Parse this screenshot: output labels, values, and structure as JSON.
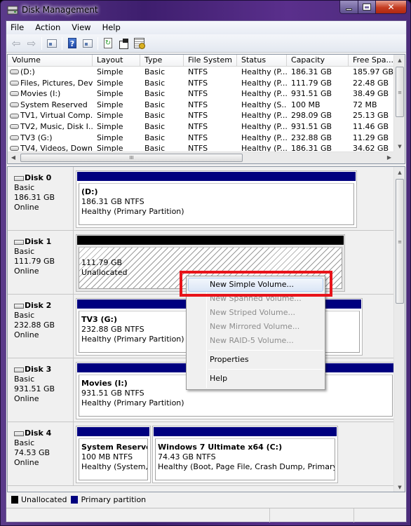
{
  "window": {
    "title": "Disk Management",
    "controls": {
      "minimize": "minimize",
      "maximize": "maximize",
      "close": "✕"
    }
  },
  "menubar": [
    "File",
    "Action",
    "View",
    "Help"
  ],
  "toolbar": {
    "buttons": [
      "back",
      "forward",
      "show-hide-console-tree",
      "help",
      "show-hide-action-pane",
      "refresh",
      "properties",
      "settings"
    ]
  },
  "volume_list": {
    "columns": [
      "Volume",
      "Layout",
      "Type",
      "File System",
      "Status",
      "Capacity",
      "Free Spa..."
    ],
    "rows": [
      [
        "(D:)",
        "Simple",
        "Basic",
        "NTFS",
        "Healthy (P...",
        "186.31 GB",
        "185.97 GB"
      ],
      [
        "Files, Pictures, Dev...",
        "Simple",
        "Basic",
        "NTFS",
        "Healthy (P...",
        "111.79 GB",
        "22.48 GB"
      ],
      [
        "Movies (I:)",
        "Simple",
        "Basic",
        "NTFS",
        "Healthy (P...",
        "931.51 GB",
        "38.49 GB"
      ],
      [
        "System Reserved",
        "Simple",
        "Basic",
        "NTFS",
        "Healthy (S...",
        "100 MB",
        "72 MB"
      ],
      [
        "TV1, Virtual Comp...",
        "Simple",
        "Basic",
        "NTFS",
        "Healthy (P...",
        "298.09 GB",
        "25.13 GB"
      ],
      [
        "TV2, Music, Disk I...",
        "Simple",
        "Basic",
        "NTFS",
        "Healthy (P...",
        "931.51 GB",
        "11.46 GB"
      ],
      [
        "TV3 (G:)",
        "Simple",
        "Basic",
        "NTFS",
        "Healthy (P...",
        "232.88 GB",
        "11.29 GB"
      ],
      [
        "TV4, Videos, Down...",
        "Simple",
        "Basic",
        "NTFS",
        "Healthy (P...",
        "186.31 GB",
        "34.62 GB"
      ]
    ],
    "hscroll_thumb_glyph": "III",
    "vscroll_thumb_glyph": "≡"
  },
  "disks": [
    {
      "name": "Disk 0",
      "type": "Basic",
      "size": "186.31 GB",
      "status": "Online",
      "partitions": [
        {
          "name": "(D:)",
          "size": "186.31 GB NTFS",
          "status": "Healthy (Primary Partition)",
          "kind": "primary"
        }
      ]
    },
    {
      "name": "Disk 1",
      "type": "Basic",
      "size": "111.79 GB",
      "status": "Online",
      "partitions": [
        {
          "name": "",
          "size": "111.79 GB",
          "status": "Unallocated",
          "kind": "unallocated"
        }
      ]
    },
    {
      "name": "Disk 2",
      "type": "Basic",
      "size": "232.88 GB",
      "status": "Online",
      "partitions": [
        {
          "name": "TV3  (G:)",
          "size": "232.88 GB NTFS",
          "status": "Healthy (Primary Partition)",
          "kind": "primary"
        }
      ]
    },
    {
      "name": "Disk 3",
      "type": "Basic",
      "size": "931.51 GB",
      "status": "Online",
      "partitions": [
        {
          "name": "Movies  (I:)",
          "size": "931.51 GB NTFS",
          "status": "Healthy (Primary Partition)",
          "kind": "primary"
        }
      ]
    },
    {
      "name": "Disk 4",
      "type": "Basic",
      "size": "74.53 GB",
      "status": "Online",
      "partitions": [
        {
          "name": "System Reserved",
          "size": "100 MB NTFS",
          "status": "Healthy (System, A",
          "kind": "primary"
        },
        {
          "name": "Windows 7 Ultimate x64  (C:)",
          "size": "74.43 GB NTFS",
          "status": "Healthy (Boot, Page File, Crash Dump, Primary Parti",
          "kind": "primary"
        }
      ]
    }
  ],
  "legend": [
    {
      "label": "Unallocated",
      "color": "#000000"
    },
    {
      "label": "Primary partition",
      "color": "#00007f"
    }
  ],
  "context_menu": {
    "items": [
      {
        "label": "New Simple Volume...",
        "enabled": true,
        "hover": true
      },
      {
        "label": "New Spanned Volume...",
        "enabled": false
      },
      {
        "label": "New Striped Volume...",
        "enabled": false
      },
      {
        "label": "New Mirrored Volume...",
        "enabled": false
      },
      {
        "label": "New RAID-5 Volume...",
        "enabled": false
      },
      {
        "label": "Properties",
        "enabled": true
      },
      {
        "label": "Help",
        "enabled": true
      }
    ]
  },
  "colors": {
    "primary_partition": "#00007f",
    "unallocated": "#000000",
    "highlight_box": "#e8131a"
  }
}
